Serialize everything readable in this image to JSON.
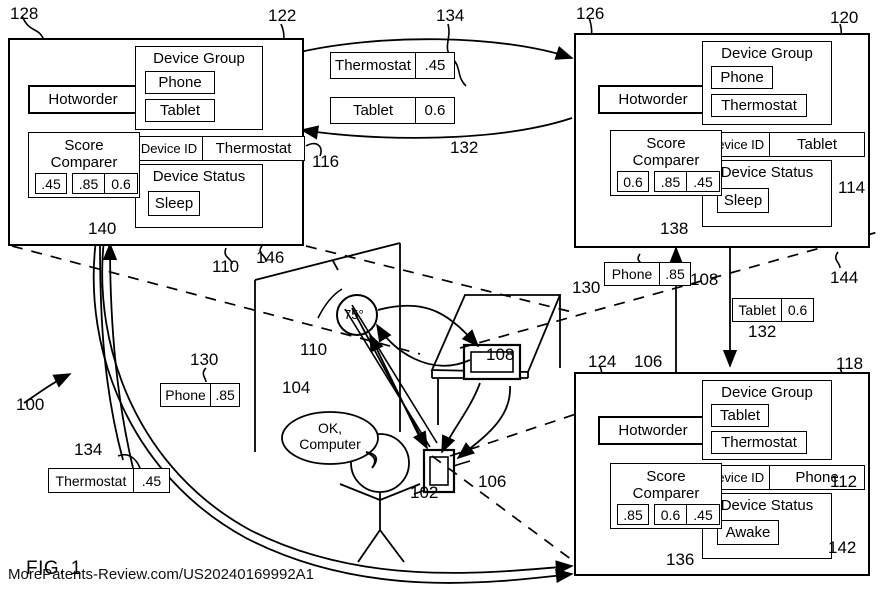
{
  "figure": {
    "label": "FIG. 1",
    "watermark": "MorePatents-Review.com/US20240169992A1",
    "system_ref": "100"
  },
  "panels": [
    {
      "id": "top-left",
      "ref_panel": "110",
      "ref_group": "122",
      "ref_hotworder": "128",
      "ref_score": "140",
      "ref_id": "116",
      "ref_status": "146",
      "hotworder": "Hotworder",
      "device_group": {
        "title": "Device Group",
        "members": [
          "Phone",
          "Tablet"
        ]
      },
      "device_id": {
        "key": "Device ID",
        "value": "Thermostat"
      },
      "device_status": {
        "title": "Device Status",
        "value": "Sleep"
      },
      "score_comparer": {
        "title_line1": "Score",
        "title_line2": "Comparer",
        "own": ".45",
        "others": [
          ".85",
          "0.6"
        ]
      }
    },
    {
      "id": "top-right",
      "ref_panel": "120",
      "ref_group": "120",
      "ref_hotworder": "126",
      "ref_score": "138",
      "ref_id": "114",
      "ref_status": "144",
      "ref_arrow": "108",
      "hotworder": "Hotworder",
      "device_group": {
        "title": "Device Group",
        "members": [
          "Phone",
          "Thermostat"
        ]
      },
      "device_id": {
        "key": "Device ID",
        "value": "Tablet"
      },
      "device_status": {
        "title": "Device Status",
        "value": "Sleep"
      },
      "score_comparer": {
        "title_line1": "Score",
        "title_line2": "Comparer",
        "own": "0.6",
        "others": [
          ".85",
          ".45"
        ]
      }
    },
    {
      "id": "bottom-right",
      "ref_panel": "118",
      "ref_group": "118",
      "ref_hotworder": "124",
      "ref_score": "136",
      "ref_id": "112",
      "ref_status": "142",
      "ref_arrow": "106",
      "hotworder": "Hotworder",
      "device_group": {
        "title": "Device Group",
        "members": [
          "Tablet",
          "Thermostat"
        ]
      },
      "device_id": {
        "key": "Device ID",
        "value": "Phone"
      },
      "device_status": {
        "title": "Device Status",
        "value": "Awake"
      },
      "score_comparer": {
        "title_line1": "Score",
        "title_line2": "Comparer",
        "own": ".85",
        "others": [
          "0.6",
          ".45"
        ]
      }
    }
  ],
  "score_messages": [
    {
      "id": "msg-thermostat-top",
      "ref": "134",
      "device": "Thermostat",
      "score": ".45"
    },
    {
      "id": "msg-tablet-top",
      "ref": "132",
      "device": "Tablet",
      "score": "0.6"
    },
    {
      "id": "msg-phone-right",
      "ref": "130",
      "device": "Phone",
      "score": ".85"
    },
    {
      "id": "msg-tablet-right",
      "ref": "132",
      "device": "Tablet",
      "score": "0.6"
    },
    {
      "id": "msg-phone-center",
      "ref": "130",
      "device": "Phone",
      "score": ".85"
    },
    {
      "id": "msg-thermostat-left",
      "ref": "134",
      "device": "Thermostat",
      "score": ".45"
    }
  ],
  "scene": {
    "user_ref": "102",
    "speech_ref": "104",
    "speech_line1": "OK,",
    "speech_line2": "Computer",
    "phone_ref": "106",
    "tablet_ref": "108",
    "thermostat_ref": "110",
    "thermostat_reading": "75°"
  },
  "refs": {
    "r100": "100",
    "r102": "102",
    "r104": "104",
    "r106": "106",
    "r108": "108",
    "r110": "110",
    "r112": "112",
    "r114": "114",
    "r116": "116",
    "r118": "118",
    "r120": "120",
    "r122": "122",
    "r124": "124",
    "r126": "126",
    "r128": "128",
    "r130": "130",
    "r132": "132",
    "r134": "134",
    "r136": "136",
    "r138": "138",
    "r140": "140",
    "r142": "142",
    "r144": "144",
    "r146": "146",
    "r108b": "108",
    "r110b": "110",
    "r130b": "130",
    "r132b": "132",
    "r134b": "134"
  }
}
